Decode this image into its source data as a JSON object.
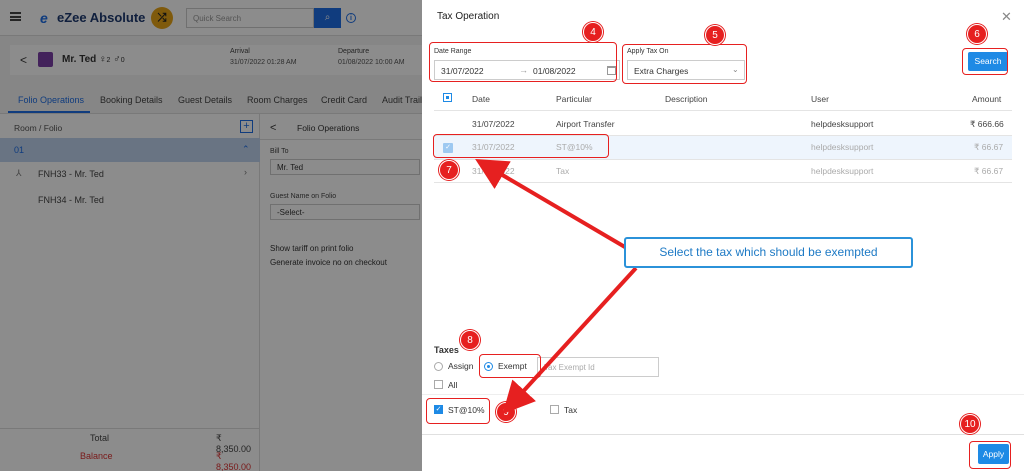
{
  "app": {
    "logo": "eZee Absolute",
    "quick_search_placeholder": "Quick Search"
  },
  "guest": {
    "name": "Mr. Ted",
    "adults": "2",
    "children": "0",
    "arrival_label": "Arrival",
    "arrival_value": "31/07/2022 01:28 AM",
    "departure_label": "Departure",
    "departure_value": "01/08/2022 10:00 AM"
  },
  "tabs": [
    "Folio Operations",
    "Booking Details",
    "Guest Details",
    "Room Charges",
    "Credit Card",
    "Audit Trail"
  ],
  "left_panel": {
    "header": "Room / Folio",
    "selected_room": "01",
    "folios": [
      "FNH33 - Mr. Ted",
      "FNH34 - Mr. Ted"
    ],
    "total_label": "Total",
    "total_value": "₹ 8,350.00",
    "balance_label": "Balance",
    "balance_value": "₹ 8,350.00"
  },
  "mid_panel": {
    "title": "Folio Operations",
    "bill_to_label": "Bill To",
    "bill_to_value": "Mr. Ted",
    "guest_name_label": "Guest Name on Folio",
    "guest_name_value": "-Select-",
    "show_tariff": "Show tariff on print folio",
    "generate_invoice": "Generate invoice no on checkout"
  },
  "dialog": {
    "title": "Tax Operation",
    "date_range_label": "Date Range",
    "date_from": "31/07/2022",
    "date_to": "01/08/2022",
    "apply_tax_on_label": "Apply Tax On",
    "apply_tax_on_value": "Extra Charges",
    "search_button": "Search",
    "columns": {
      "date": "Date",
      "particular": "Particular",
      "description": "Description",
      "user": "User",
      "amount": "Amount"
    },
    "rows": [
      {
        "date": "31/07/2022",
        "particular": "Airport Transfer",
        "description": "",
        "user": "helpdesksupport",
        "amount": "₹ 666.66"
      },
      {
        "date": "31/07/2022",
        "particular": "ST@10%",
        "description": "",
        "user": "helpdesksupport",
        "amount": "₹ 66.67"
      },
      {
        "date": "31/07/2022",
        "particular": "Tax",
        "description": "",
        "user": "helpdesksupport",
        "amount": "₹ 66.67"
      }
    ],
    "taxes_label": "Taxes",
    "assign_label": "Assign",
    "exempt_label": "Exempt",
    "exempt_id_placeholder": "Tax Exempt Id",
    "all_label": "All",
    "tax_options": [
      "ST@10%",
      "Tax"
    ],
    "apply_button": "Apply"
  },
  "annotations": {
    "callout": "Select the tax which should be exempted",
    "numbers": [
      "4",
      "5",
      "6",
      "7",
      "8",
      "9",
      "10"
    ],
    "color": "#e62020"
  },
  "colors": {
    "accent": "#1e8ae5",
    "overlay": "rgba(0,0,0,0.45)"
  }
}
